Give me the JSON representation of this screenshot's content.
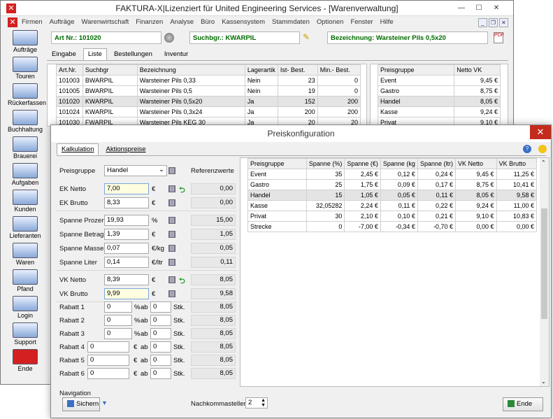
{
  "window": {
    "title": "FAKTURA-X|Lizenziert für United Engineering Services - [Warenverwaltung]"
  },
  "menu": [
    "Firmen",
    "Aufträge",
    "Warenwirtschaft",
    "Finanzen",
    "Analyse",
    "Büro",
    "Kassensystem",
    "Stammdaten",
    "Optionen",
    "Fenster",
    "Hilfe"
  ],
  "toolbar": [
    "Aufträge",
    "Touren",
    "Rückerfassen",
    "Buchhaltung",
    "Brauerei",
    "Aufgaben",
    "Kunden",
    "Lieferanten",
    "Waren",
    "Pfand",
    "Login",
    "Support",
    "Ende"
  ],
  "header_fields": {
    "art_nr": "Art Nr.: 101020",
    "suchbgr": "Suchbgr.: KWARPIL",
    "bezeichnung": "Bezeichnung: Warsteiner Pils 0,5x20"
  },
  "main_tabs": [
    "Eingabe",
    "Liste",
    "Bestellungen",
    "Inventur"
  ],
  "article_table": {
    "headers": [
      "Art.Nr.",
      "Suchbgr",
      "Bezeichnung",
      "Lagerartik",
      "Ist- Best.",
      "Min.- Best."
    ],
    "rows": [
      [
        "101003",
        "BWARPIL",
        "Warsteiner Pils 0,33",
        "Nein",
        "23",
        "0"
      ],
      [
        "101005",
        "BWARPIL",
        "Warsteiner Pils 0,5",
        "Nein",
        "19",
        "0"
      ],
      [
        "101020",
        "KWARPIL",
        "Warsteiner Pils 0,5x20",
        "Ja",
        "152",
        "200"
      ],
      [
        "101024",
        "KWARPIL",
        "Warsteiner Pils 0,3x24",
        "Ja",
        "200",
        "200"
      ],
      [
        "101030",
        "FWARPIL",
        "Warsteiner Pils KEG 30",
        "Ja",
        "20",
        "20"
      ]
    ]
  },
  "price_table_small": {
    "headers": [
      "Preisgruppe",
      "Netto VK"
    ],
    "rows": [
      [
        "Event",
        "9,45 €"
      ],
      [
        "Gastro",
        "8,75 €"
      ],
      [
        "Handel",
        "8,05 €"
      ],
      [
        "Kasse",
        "9,24 €"
      ],
      [
        "Privat",
        "9,10 €"
      ]
    ]
  },
  "dialog": {
    "title": "Preiskonfiguration",
    "tabs": [
      "Kalkulation",
      "Aktionspreise"
    ],
    "preisgruppe_label": "Preisgruppe",
    "preisgruppe_value": "Handel",
    "referenz_label": "Referenzwerte",
    "rows": [
      {
        "label": "EK Netto",
        "value": "7,00",
        "unit": "€",
        "ref": "0,00"
      },
      {
        "label": "EK Brutto",
        "value": "8,33",
        "unit": "€",
        "ref": "0,00"
      },
      {
        "label": "Spanne Prozent",
        "value": "19,93",
        "unit": "%",
        "ref": "15,00"
      },
      {
        "label": "Spanne Betrag",
        "value": "1,39",
        "unit": "€",
        "ref": "1,05"
      },
      {
        "label": "Spanne Masse",
        "value": "0,07",
        "unit": "€/kg",
        "ref": "0,05"
      },
      {
        "label": "Spanne Liter",
        "value": "0,14",
        "unit": "€/ltr",
        "ref": "0,11"
      },
      {
        "label": "VK Netto",
        "value": "8,39",
        "unit": "€",
        "ref": "8,05"
      },
      {
        "label": "VK Brutto",
        "value": "9,99",
        "unit": "€",
        "ref": "9,58"
      }
    ],
    "rabatt": [
      {
        "label": "Rabatt 1",
        "value": "0",
        "sym": "%",
        "ab": "ab",
        "qty": "0",
        "stk": "Stk.",
        "ref": "8,05"
      },
      {
        "label": "Rabatt 2",
        "value": "0",
        "sym": "%",
        "ab": "ab",
        "qty": "0",
        "stk": "Stk.",
        "ref": "8,05"
      },
      {
        "label": "Rabatt 3",
        "value": "0",
        "sym": "%",
        "ab": "ab",
        "qty": "0",
        "stk": "Stk.",
        "ref": "8,05"
      },
      {
        "label": "Rabatt 4",
        "value": "0",
        "sym": "€",
        "ab": "ab",
        "qty": "0",
        "stk": "Stk.",
        "ref": "8,05"
      },
      {
        "label": "Rabatt 5",
        "value": "0",
        "sym": "€",
        "ab": "ab",
        "qty": "0",
        "stk": "Stk.",
        "ref": "8,05"
      },
      {
        "label": "Rabatt 6",
        "value": "0",
        "sym": "€",
        "ab": "ab",
        "qty": "0",
        "stk": "Stk.",
        "ref": "8,05"
      }
    ],
    "price_table": {
      "headers": [
        "Preisgruppe",
        "Spanne (%)",
        "Spanne (€)",
        "Spanne (kg",
        "Spanne (ltr)",
        "VK Netto",
        "VK Brutto"
      ],
      "rows": [
        [
          "Event",
          "35",
          "2,45 €",
          "0,12 €",
          "0,24 €",
          "9,45 €",
          "11,25 €"
        ],
        [
          "Gastro",
          "25",
          "1,75 €",
          "0,09 €",
          "0,17 €",
          "8,75 €",
          "10,41 €"
        ],
        [
          "Handel",
          "15",
          "1,05 €",
          "0,05 €",
          "0,11 €",
          "8,05 €",
          "9,58 €"
        ],
        [
          "Kasse",
          "32,05282",
          "2,24 €",
          "0,11 €",
          "0,22 €",
          "9,24 €",
          "11,00 €"
        ],
        [
          "Privat",
          "30",
          "2,10 €",
          "0,10 €",
          "0,21 €",
          "9,10 €",
          "10,83 €"
        ],
        [
          "Strecke",
          "0",
          "-7,00 €",
          "-0,34 €",
          "-0,70 €",
          "0,00 €",
          "0,00 €"
        ]
      ]
    },
    "navigation_label": "Navigation",
    "sichern": "Sichern",
    "nachkomma_label": "Nachkommastellen",
    "nachkomma_value": "2",
    "ende": "Ende"
  }
}
